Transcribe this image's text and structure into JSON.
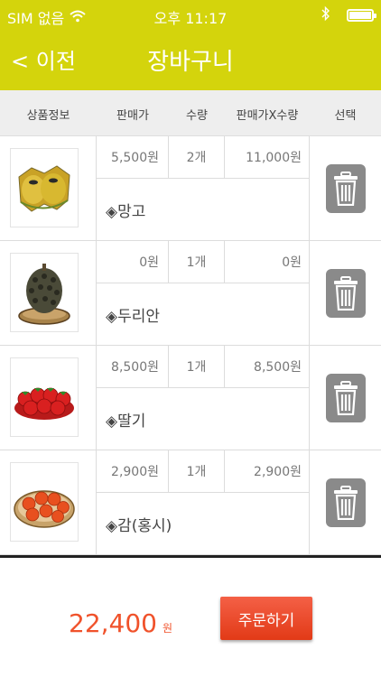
{
  "status_bar": {
    "carrier": "SIM 없음",
    "time": "오후 11:17",
    "icons": [
      "wifi-icon",
      "bluetooth-icon",
      "battery-icon"
    ]
  },
  "nav": {
    "back_label": "< 이전",
    "title": "장바구니"
  },
  "columns": {
    "product_info": "상품정보",
    "price": "판매가",
    "quantity": "수량",
    "subtotal": "판매가X수량",
    "select": "선택"
  },
  "items": [
    {
      "price": "5,500원",
      "qty": "2개",
      "subtotal": "11,000원",
      "name": "◈망고",
      "image": "mango-image"
    },
    {
      "price": "0원",
      "qty": "1개",
      "subtotal": "0원",
      "name": "◈두리안",
      "image": "durian-image"
    },
    {
      "price": "8,500원",
      "qty": "1개",
      "subtotal": "8,500원",
      "name": "◈딸기",
      "image": "strawberry-image"
    },
    {
      "price": "2,900원",
      "qty": "1개",
      "subtotal": "2,900원",
      "name": "◈감(홍시)",
      "image": "persimmon-image"
    }
  ],
  "footer": {
    "total": "22,400",
    "total_unit": "원",
    "order_label": "주문하기"
  },
  "colors": {
    "header": "#d4d40c",
    "accent": "#f0522b",
    "trash": "#8a8a8a"
  }
}
